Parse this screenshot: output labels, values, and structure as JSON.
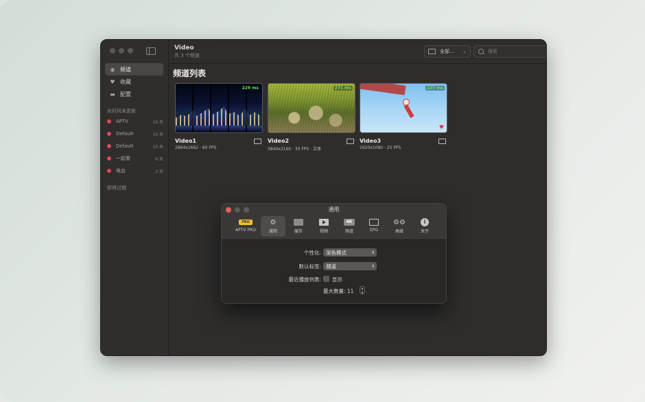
{
  "window": {
    "title": "Video",
    "subtitle": "共 3 个频道",
    "filter_label": "全部...",
    "search_placeholder": "搜索"
  },
  "sidebar": {
    "items": [
      {
        "label": "频道",
        "icon": "antenna-icon",
        "active": true
      },
      {
        "label": "收藏",
        "icon": "heart-icon",
        "active": false
      },
      {
        "label": "配置",
        "icon": "folder-icon",
        "active": false
      }
    ],
    "recent_section": "长时间未更新",
    "channels": [
      {
        "name": "APTV",
        "time": "10 天"
      },
      {
        "name": "Default",
        "time": "10 天"
      },
      {
        "name": "Default",
        "time": "10 天"
      },
      {
        "name": "一起看",
        "time": "6 天"
      },
      {
        "name": "电台",
        "time": "3 天"
      }
    ],
    "expiring_section": "即将过期"
  },
  "main": {
    "heading": "频道列表",
    "videos": [
      {
        "title": "Video1",
        "spec": "2864x1662 · 60 FPS",
        "latency": "229 ms"
      },
      {
        "title": "Video2",
        "spec": "3840x2160 · 30 FPS · 立体",
        "latency": "271 ms"
      },
      {
        "title": "Video3",
        "spec": "1920x1080 · 25 FPS",
        "latency": "227 ms"
      }
    ]
  },
  "prefs": {
    "title": "通用",
    "tabs": [
      {
        "label": "APTV PRO",
        "icon": "aptv-pro-icon",
        "active": false
      },
      {
        "label": "通用",
        "icon": "general-gear-icon",
        "active": true
      },
      {
        "label": "缓存",
        "icon": "cache-folder-icon",
        "active": false
      },
      {
        "label": "视频",
        "icon": "video-play-icon",
        "active": false
      },
      {
        "label": "频道",
        "icon": "channel-4k-icon",
        "active": false
      },
      {
        "label": "EPG",
        "icon": "epg-icon",
        "active": false
      },
      {
        "label": "高级",
        "icon": "advanced-gears-icon",
        "active": false
      },
      {
        "label": "关于",
        "icon": "about-info-icon",
        "active": false
      }
    ],
    "aptv_badge": "PRO",
    "fields": {
      "personalize_label": "个性化:",
      "personalize_value": "深色模式",
      "default_tab_label": "默认标签:",
      "default_tab_value": "频道",
      "recent_label": "最近播放列表:",
      "recent_checkbox": "显示",
      "max_label": "最大数量: 11"
    }
  }
}
